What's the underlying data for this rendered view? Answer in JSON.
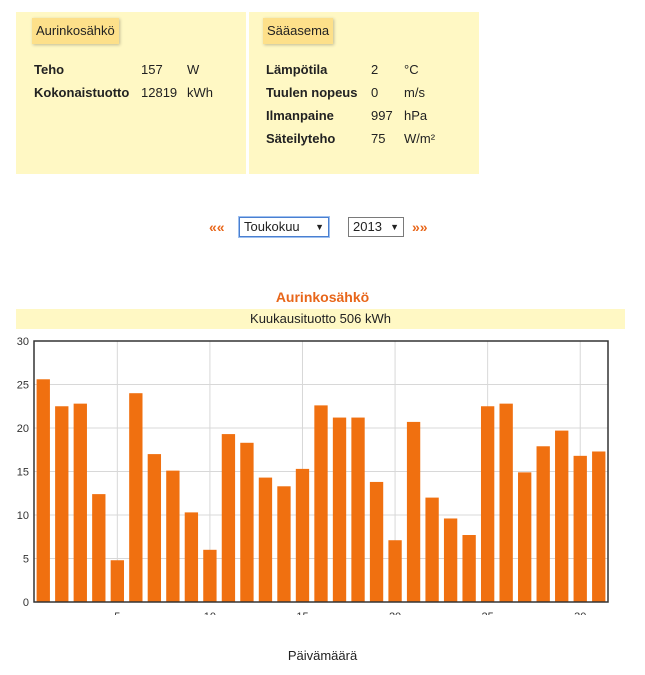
{
  "solar_panel": {
    "title": "Aurinkosähkö",
    "rows": [
      {
        "label": "Teho",
        "value": "157",
        "unit": "W"
      },
      {
        "label": "Kokonaistuotto",
        "value": "12819",
        "unit": "kWh"
      }
    ]
  },
  "weather_panel": {
    "title": "Sääasema",
    "rows": [
      {
        "label": "Lämpötila",
        "value": "2",
        "unit": "°C"
      },
      {
        "label": "Tuulen nopeus",
        "value": "0",
        "unit": "m/s"
      },
      {
        "label": "Ilmanpaine",
        "value": "997",
        "unit": "hPa"
      },
      {
        "label": "Säteilyteho",
        "value": "75",
        "unit": "W/m²"
      }
    ]
  },
  "nav": {
    "prev_label": "««",
    "next_label": "»»",
    "month_selected": "Toukokuu",
    "year_selected": "2013",
    "caret": "▼"
  },
  "colors": {
    "accent": "#e8661a",
    "bar": "#f07010",
    "panel_bg": "#fff8c4"
  },
  "chart_data": {
    "type": "bar",
    "title": "Aurinkosähkö",
    "subtitle": "Kuukausituotto 506 kWh",
    "xlabel": "Päivämäärä",
    "ylabel": "",
    "x": [
      1,
      2,
      3,
      4,
      5,
      6,
      7,
      8,
      9,
      10,
      11,
      12,
      13,
      14,
      15,
      16,
      17,
      18,
      19,
      20,
      21,
      22,
      23,
      24,
      25,
      26,
      27,
      28,
      29,
      30,
      31
    ],
    "values": [
      25.6,
      22.5,
      22.8,
      12.4,
      4.8,
      24.0,
      17.0,
      15.1,
      10.3,
      6.0,
      19.3,
      18.3,
      14.3,
      13.3,
      15.3,
      22.6,
      21.2,
      21.2,
      13.8,
      7.1,
      20.7,
      12.0,
      9.6,
      7.7,
      22.5,
      22.8,
      14.9,
      17.9,
      19.7,
      16.8,
      17.3
    ],
    "ylim": [
      0,
      30
    ],
    "yticks": [
      0,
      5,
      10,
      15,
      20,
      25,
      30
    ],
    "xticks": [
      5,
      10,
      15,
      20,
      25,
      30
    ],
    "grid": true
  }
}
